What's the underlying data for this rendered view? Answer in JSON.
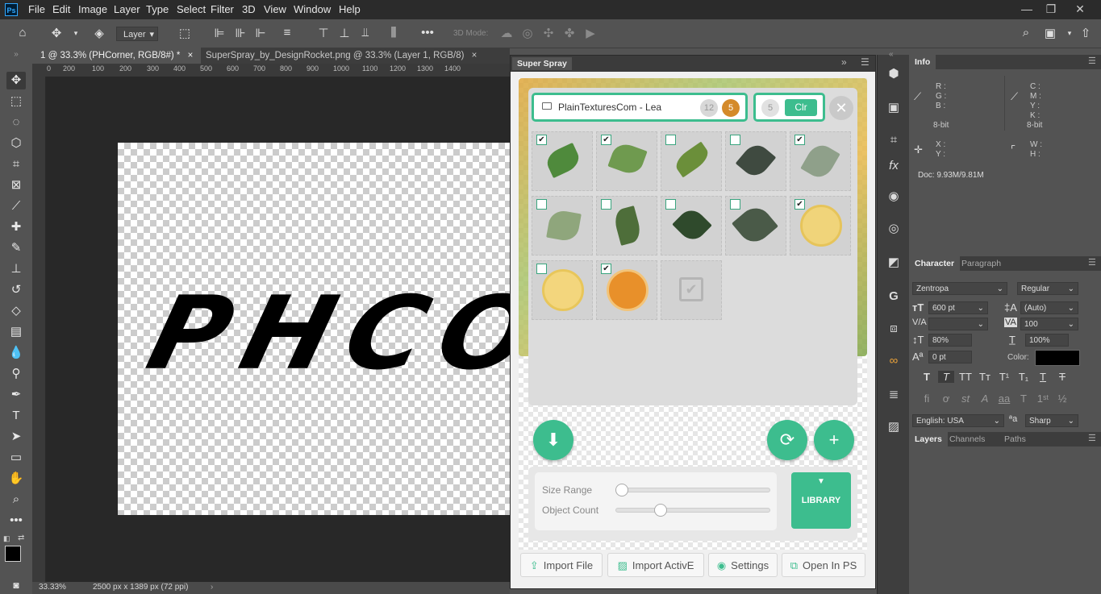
{
  "app": {
    "logo": "Ps"
  },
  "menu": [
    "File",
    "Edit",
    "Image",
    "Layer",
    "Type",
    "Select",
    "Filter",
    "3D",
    "View",
    "Window",
    "Help"
  ],
  "options": {
    "layer_select": "Layer",
    "mode_3d": "3D Mode:"
  },
  "tabs": [
    {
      "label": "1 @ 33.3% (PHCorner, RGB/8#) *",
      "close": "×"
    },
    {
      "label": "SuperSpray_by_DesignRocket.png @ 33.3% (Layer 1, RGB/8)",
      "close": "×"
    }
  ],
  "ruler": [
    "0",
    "200",
    "100",
    "200",
    "300",
    "400",
    "500",
    "600",
    "700",
    "800",
    "900",
    "1000",
    "1100",
    "1200",
    "1300",
    "1400"
  ],
  "canvas": {
    "text": "PHCORN"
  },
  "status": {
    "zoom": "33.33%",
    "doc_size": "2500 px x 1389 px (72 ppi)"
  },
  "superspray": {
    "title": "Super Spray",
    "folder": "PlainTexturesCom - Lea",
    "count_total": "12",
    "count_selected": "5",
    "count_clear": "5",
    "clear_label": "Clr",
    "items_checked": [
      true,
      true,
      false,
      false,
      true,
      false,
      false,
      false,
      false,
      true,
      false,
      true,
      false
    ],
    "size_range_label": "Size Range",
    "object_count_label": "Object Count",
    "size_range_value": 0,
    "object_count_value": 0.27,
    "library_label": "LIBRARY",
    "footer": [
      "Import File",
      "Import ActivE",
      "Settings",
      "Open In PS"
    ]
  },
  "info": {
    "tab": "Info",
    "rgb": [
      "R :",
      "G :",
      "B :"
    ],
    "cmyk": [
      "C :",
      "M :",
      "Y :",
      "K :"
    ],
    "bit1": "8-bit",
    "bit2": "8-bit",
    "xy": [
      "X :",
      "Y :"
    ],
    "wh": [
      "W :",
      "H :"
    ],
    "doc": "Doc: 9.93M/9.81M"
  },
  "character": {
    "tabs": [
      "Character",
      "Paragraph"
    ],
    "font": "Zentropa",
    "style": "Regular",
    "size": "600 pt",
    "leading": "(Auto)",
    "kerning": "",
    "tracking": "100",
    "vscale": "80%",
    "hscale": "100%",
    "baseline": "0 pt",
    "color_label": "Color:",
    "language": "English: USA",
    "aa": "Sharp"
  },
  "layers": {
    "tabs": [
      "Layers",
      "Channels",
      "Paths"
    ]
  }
}
